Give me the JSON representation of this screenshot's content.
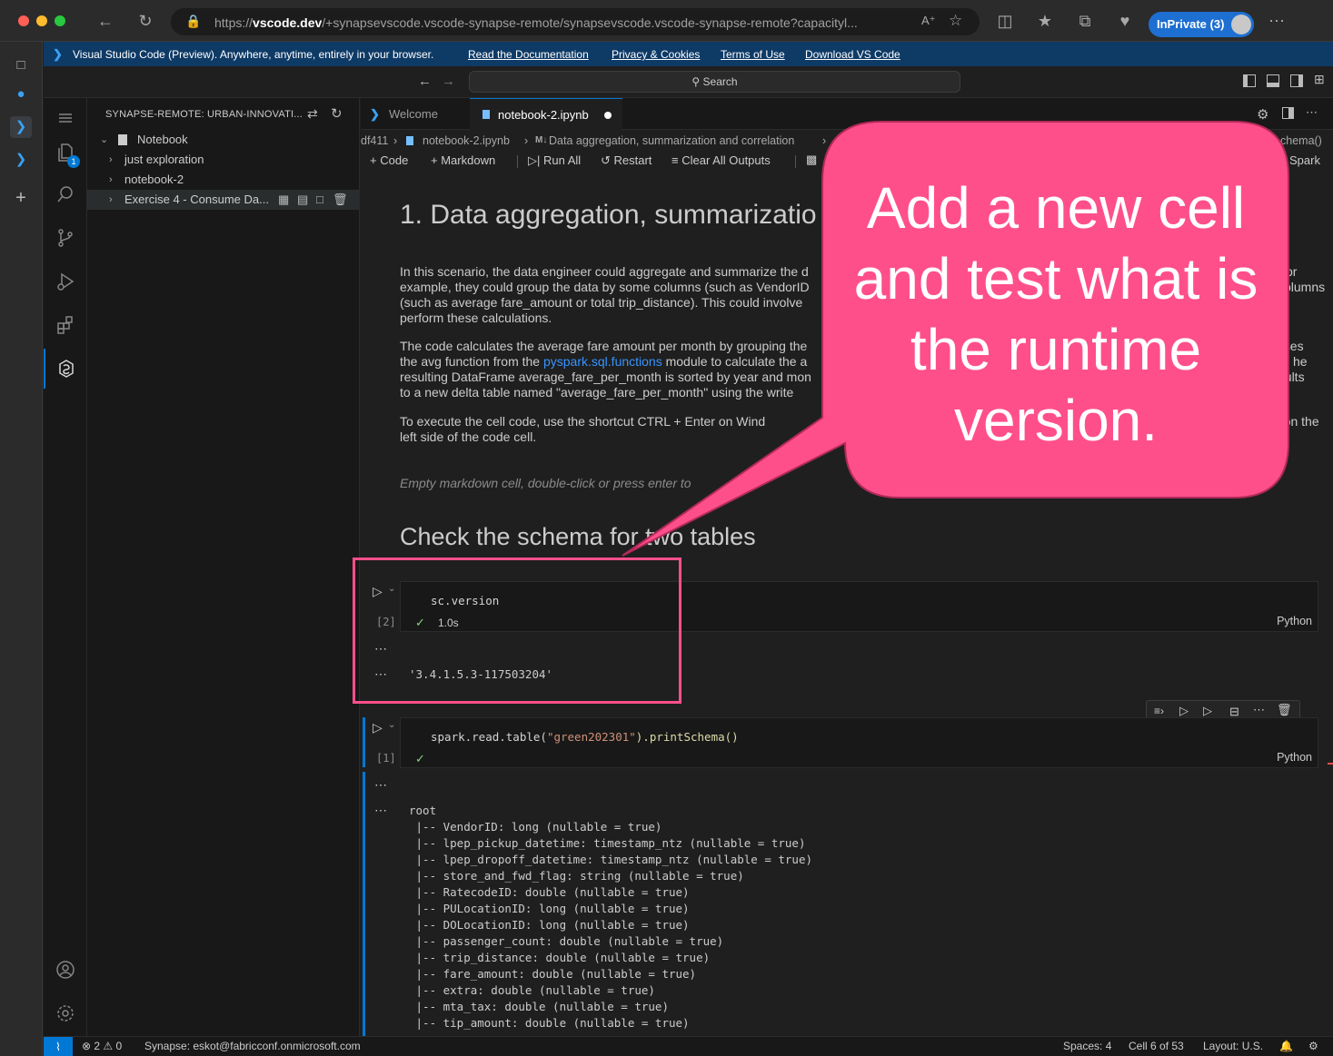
{
  "browser": {
    "url_prefix": "https://",
    "url_host": "vscode.dev",
    "url_rest": "/+synapsevscode.vscode-synapse-remote/synapsevscode.vscode-synapse-remote?capacityl...",
    "inprivate_label": "InPrivate (3)"
  },
  "banner": {
    "text": "Visual Studio Code (Preview). Anywhere, anytime, entirely in your browser.",
    "links": [
      "Read the Documentation",
      "Privacy & Cookies",
      "Terms of Use",
      "Download VS Code"
    ]
  },
  "titlebar": {
    "search_placeholder": "Search"
  },
  "activity_bar": {
    "explorer_badge": "1"
  },
  "sidebar": {
    "title": "SYNAPSE-REMOTE: URBAN-INNOVATI...",
    "root": "Notebook",
    "items": [
      "just exploration",
      "notebook-2",
      "Exercise 4 - Consume Da..."
    ]
  },
  "tabs": [
    {
      "label": "Welcome",
      "active": false
    },
    {
      "label": "notebook-2.ipynb",
      "active": true,
      "modified": true
    }
  ],
  "breadcrumb": {
    "part1": "df411",
    "part2": "notebook-2.ipynb",
    "part3_prefix": "M↓",
    "part3": "Data aggregation, summarization and correlation",
    "tail": "chema()"
  },
  "toolbar": {
    "code": "Code",
    "markdown": "Markdown",
    "run_all": "Run All",
    "restart": "Restart",
    "clear_outputs": "Clear All Outputs",
    "kernel": "Spark"
  },
  "notebook": {
    "heading1": "1. Data aggregation, summarizatio",
    "para1": [
      "In this scenario, the data engineer could aggregate and summarize the d",
      "example, they could group the data by some columns (such as VendorID",
      "(such as average fare_amount or total trip_distance). This could involve",
      "perform these calculations."
    ],
    "para1_right": [
      "or",
      "olumns"
    ],
    "para2": [
      "The code calculates the average fare amount per month by grouping the",
      "module to calculate the a",
      "resulting DataFrame average_fare_per_month is sorted by year and mon",
      "to a new delta table named \"average_fare_per_month\" using the write"
    ],
    "para2_prefix": "the avg function from the",
    "para2_link": "pyspark.sql.functions",
    "para2_right": [
      "uses",
      "he",
      "esults"
    ],
    "para3": [
      "To execute the cell code, use the shortcut CTRL + Enter on Wind",
      "left side of the code cell."
    ],
    "para3_right": "d on the",
    "empty_md": "Empty markdown cell, double-click or press enter to",
    "heading2": "Check the schema for two tables"
  },
  "cell1": {
    "code": "sc.version",
    "exec_count": "[2]",
    "duration": "1.0s",
    "language": "Python",
    "output": "'3.4.1.5.3-117503204'"
  },
  "cell2": {
    "code_prefix": "spark.read.table(",
    "code_string": "\"green202301\"",
    "code_suffix": ").printSchema()",
    "exec_count": "[1]",
    "language": "Python",
    "output_lines": [
      "root",
      " |-- VendorID: long (nullable = true)",
      " |-- lpep_pickup_datetime: timestamp_ntz (nullable = true)",
      " |-- lpep_dropoff_datetime: timestamp_ntz (nullable = true)",
      " |-- store_and_fwd_flag: string (nullable = true)",
      " |-- RatecodeID: double (nullable = true)",
      " |-- PULocationID: long (nullable = true)",
      " |-- DOLocationID: long (nullable = true)",
      " |-- passenger_count: double (nullable = true)",
      " |-- trip_distance: double (nullable = true)",
      " |-- fare_amount: double (nullable = true)",
      " |-- extra: double (nullable = true)",
      " |-- mta_tax: double (nullable = true)",
      " |-- tip_amount: double (nullable = true)"
    ]
  },
  "statusbar": {
    "errors": "2",
    "warnings": "0",
    "account": "Synapse: eskot@fabricconf.onmicrosoft.com",
    "spaces": "Spaces: 4",
    "cell": "Cell 6 of 53",
    "layout": "Layout: U.S."
  },
  "annotation": {
    "text": "Add a new cell and test what is the runtime version.",
    "color": "#ff4f8b"
  }
}
